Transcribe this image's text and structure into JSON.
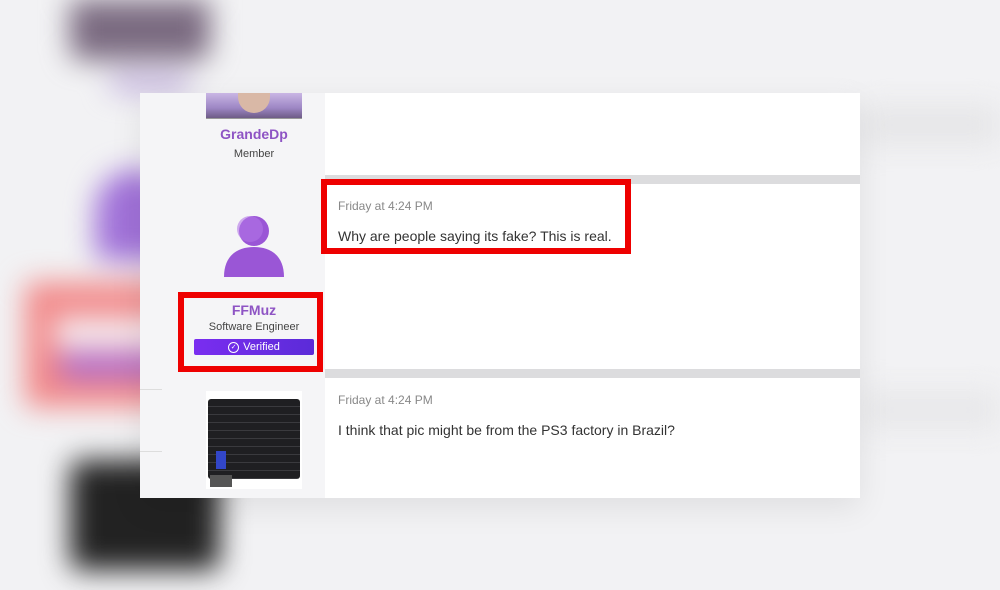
{
  "posts": [
    {
      "author": {
        "name": "GrandeDp",
        "title": "Member",
        "avatar": "photo-avatar"
      },
      "timestamp": "",
      "message": ""
    },
    {
      "author": {
        "name": "FFMuz",
        "title": "Software Engineer",
        "badge": "Verified",
        "avatar": "person-icon"
      },
      "timestamp": "Friday at 4:24 PM",
      "message": "Why are people saying its fake? This is real."
    },
    {
      "author": {
        "avatar": "console-image"
      },
      "timestamp": "Friday at 4:24 PM",
      "message": "I think that pic might be from the PS3 factory in Brazil?"
    }
  ],
  "colors": {
    "username": "#8e54c4",
    "badge_gradient_start": "#7a2df0",
    "badge_gradient_end": "#5b2bd8",
    "highlight": "#ee0000",
    "separator": "#dcdcde",
    "user_column_bg": "#f5f5f7"
  },
  "icons": [
    "person-icon",
    "check-circle-icon"
  ]
}
